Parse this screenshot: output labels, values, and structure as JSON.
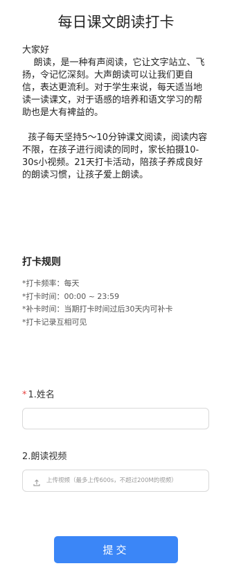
{
  "page": {
    "title": "每日课文朗读打卡"
  },
  "intro": {
    "greeting": "大家好",
    "paragraph1": "    朗读，是一种有声阅读，它让文字站立、飞扬，令记忆深刻。大声朗读可以让我们更自信，表达更流利。对于学生来说，每天适当地读一读课文，对于语感的培养和语文学习的帮助也是大有裨益的。",
    "paragraph2": "  孩子每天坚持5～10分钟课文阅读，阅读内容不限，在孩子进行阅读的同时，家长拍摄10-30s小视频。21天打卡活动，陪孩子养成良好的朗读习惯，让孩子爱上朗读。"
  },
  "rules": {
    "title": "打卡规则",
    "items": [
      "*打卡频率：每天",
      "*打卡时间：00:00 ~ 23:59",
      "*补卡时间：当期打卡时间过后30天内可补卡",
      "*打卡记录互相可见"
    ]
  },
  "form": {
    "name_required_mark": "*",
    "name_label": "1.姓名",
    "name_value": "",
    "video_label": "2.朗读视频",
    "upload_icon": "upload-icon",
    "upload_hint": "上传视频（最多上传600s，不超过200M的视频）",
    "submit_label": "提交"
  },
  "colors": {
    "accent": "#3b86f7",
    "required": "#e64340"
  }
}
